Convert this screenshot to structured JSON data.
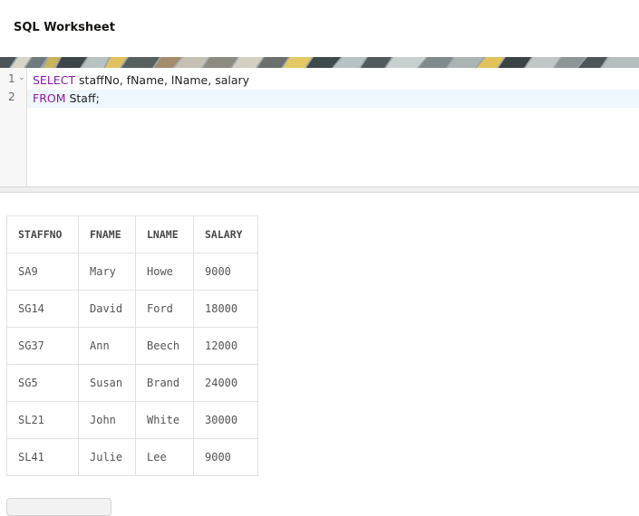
{
  "header": {
    "title": "SQL Worksheet"
  },
  "editor": {
    "lines": [
      {
        "number": "1",
        "keyword": "SELECT",
        "rest": " staffNo, fName, lName, salary",
        "foldable": true
      },
      {
        "number": "2",
        "keyword": "FROM",
        "rest": " Staff;",
        "foldable": false
      }
    ],
    "fold_glyph": "⌄"
  },
  "results": {
    "columns": [
      "STAFFNO",
      "FNAME",
      "LNAME",
      "SALARY"
    ],
    "rows": [
      [
        "SA9",
        "Mary",
        "Howe",
        "9000"
      ],
      [
        "SG14",
        "David",
        "Ford",
        "18000"
      ],
      [
        "SG37",
        "Ann",
        "Beech",
        "12000"
      ],
      [
        "SG5",
        "Susan",
        "Brand",
        "24000"
      ],
      [
        "SL21",
        "John",
        "White",
        "30000"
      ],
      [
        "SL41",
        "Julie",
        "Lee",
        "9000"
      ]
    ]
  },
  "colors": {
    "keyword": "#8a1ba6",
    "active_line": "#eef7fb"
  }
}
